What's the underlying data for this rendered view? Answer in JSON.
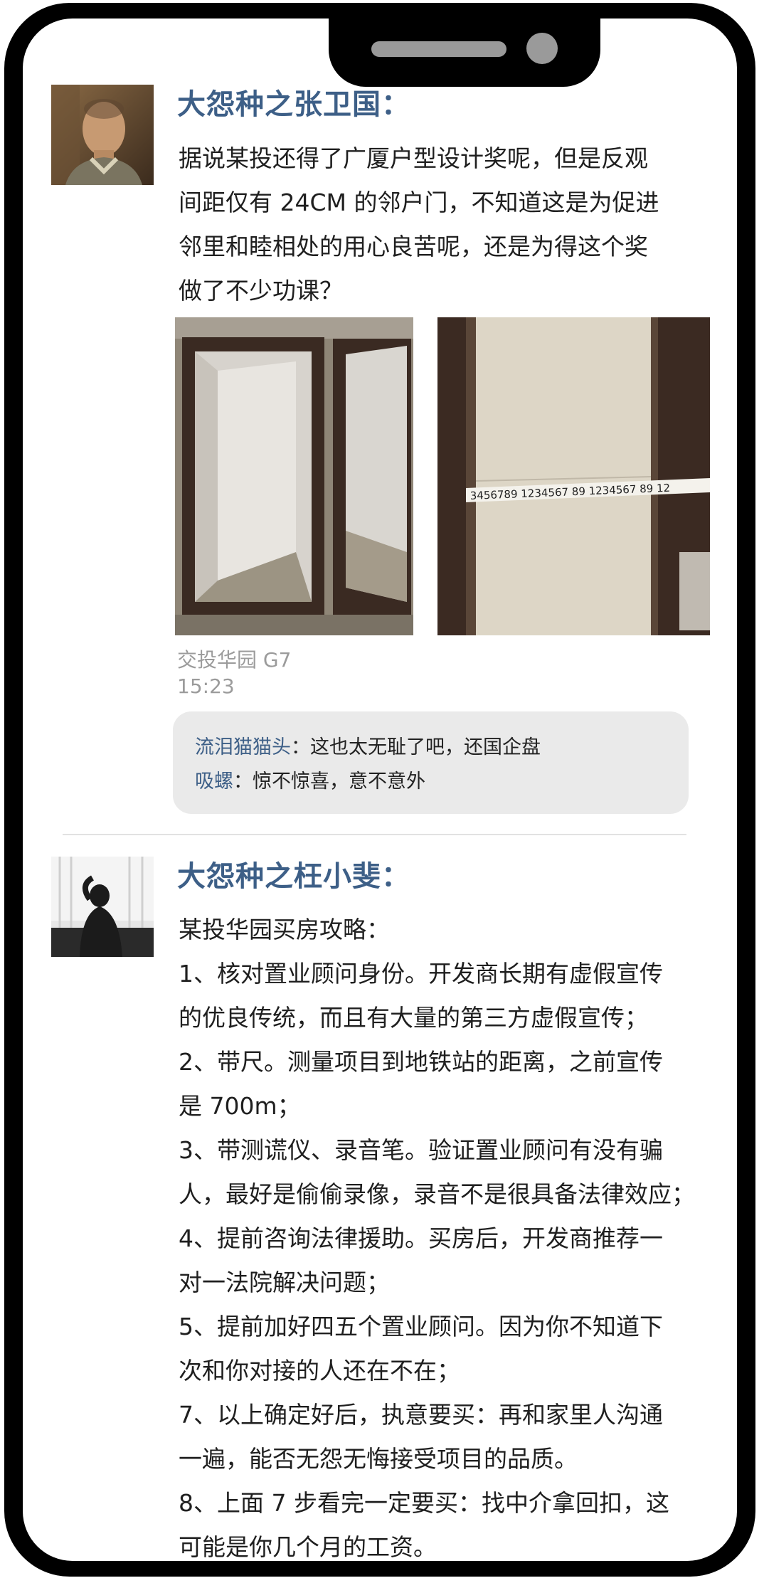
{
  "posts": [
    {
      "author": "大怨种之张卫国：",
      "lines": [
        "据说某投还得了广厦户型设计奖呢，但是反观",
        "间距仅有 24CM 的邻户门，不知道这是为促进",
        "邻里和睦相处的用心良苦呢，还是为得这个奖",
        "做了不少功课？"
      ],
      "location": "交投华园 G7",
      "time": "15:23",
      "comments": [
        {
          "name": "流泪猫猫头",
          "sep": "：",
          "text": "这也太无耻了吧，还国企盘"
        },
        {
          "name": "吸螺",
          "sep": "：",
          "text": "惊不惊喜，意不意外"
        }
      ]
    },
    {
      "author": "大怨种之枉小斐：",
      "lines": [
        "某投华园买房攻略：",
        "1、核对置业顾问身份。开发商长期有虚假宣传",
        "的优良传统，而且有大量的第三方虚假宣传；",
        "2、带尺。测量项目到地铁站的距离，之前宣传",
        "是 700m；",
        "3、带测谎仪、录音笔。验证置业顾问有没有骗",
        "人，最好是偷偷录像，录音不是很具备法律效应；",
        "4、提前咨询法律援助。买房后，开发商推荐一",
        "对一法院解决问题；",
        "5、提前加好四五个置业顾问。因为你不知道下",
        "次和你对接的人还在不在；",
        "7、以上确定好后，执意要买：再和家里人沟通",
        "一遍，能否无怨无悔接受项目的品质。",
        "8、上面 7 步看完一定要买：找中介拿回扣，这",
        "可能是你几个月的工资。"
      ]
    }
  ],
  "tape_numbers": "3456789 1234567 89 1234567 89 12",
  "colors": {
    "author": "#3d5f87",
    "body_text": "#1f1f1f",
    "meta_text": "#9b9b9b",
    "comment_bg": "#eaeaea",
    "phone_frame": "#000000"
  }
}
